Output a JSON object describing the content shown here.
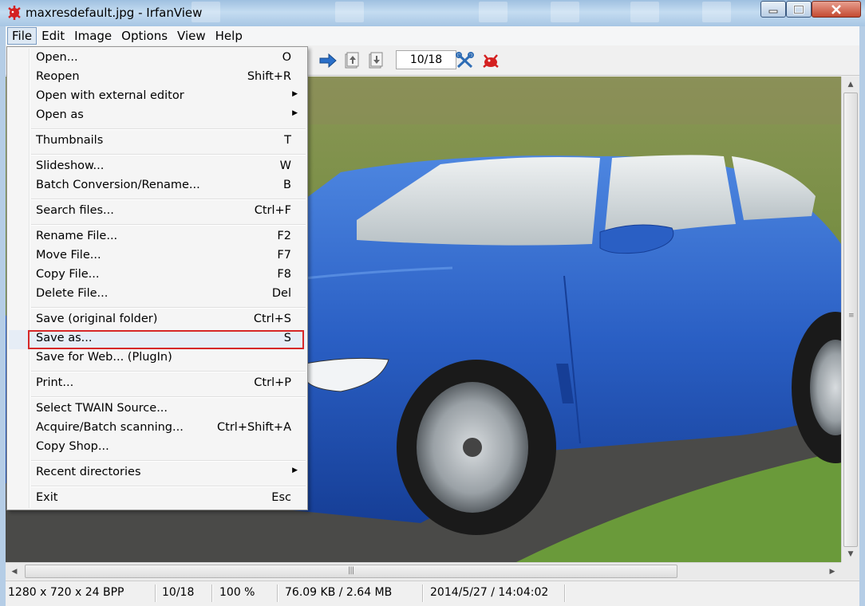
{
  "window": {
    "title": "maxresdefault.jpg - IrfanView"
  },
  "menubar": {
    "items": [
      "File",
      "Edit",
      "Image",
      "Options",
      "View",
      "Help"
    ],
    "active": "File"
  },
  "toolbar": {
    "page_indicator": "10/18",
    "icons": [
      "next-arrow-icon",
      "first-page-icon",
      "last-page-icon",
      "settings-tools-icon",
      "irfanview-logo-icon"
    ]
  },
  "file_menu": {
    "items": [
      {
        "label": "Open...",
        "key": "O"
      },
      {
        "label": "Reopen",
        "key": "Shift+R"
      },
      {
        "label": "Open with external editor",
        "key": "",
        "submenu": true
      },
      {
        "label": "Open as",
        "key": "",
        "submenu": true
      },
      {
        "label": "Thumbnails",
        "key": "T"
      },
      {
        "label": "Slideshow...",
        "key": "W"
      },
      {
        "label": "Batch Conversion/Rename...",
        "key": "B"
      },
      {
        "label": "Search files...",
        "key": "Ctrl+F"
      },
      {
        "label": "Rename File...",
        "key": "F2"
      },
      {
        "label": "Move File...",
        "key": "F7"
      },
      {
        "label": "Copy File...",
        "key": "F8"
      },
      {
        "label": "Delete File...",
        "key": "Del"
      },
      {
        "label": "Save (original folder)",
        "key": "Ctrl+S"
      },
      {
        "label": "Save as...",
        "key": "S",
        "highlighted": true
      },
      {
        "label": "Save for Web... (PlugIn)",
        "key": ""
      },
      {
        "label": "Print...",
        "key": "Ctrl+P"
      },
      {
        "label": "Select TWAIN Source...",
        "key": ""
      },
      {
        "label": "Acquire/Batch scanning...",
        "key": "Ctrl+Shift+A"
      },
      {
        "label": "Copy Shop...",
        "key": ""
      },
      {
        "label": "Recent directories",
        "key": "",
        "submenu": true
      },
      {
        "label": "Exit",
        "key": "Esc"
      }
    ]
  },
  "statusbar": {
    "dimensions": "1280 x 720 x 24 BPP",
    "position": "10/18",
    "zoom": "100 %",
    "filesize": "76.09 KB / 2.64 MB",
    "datetime": "2014/5/27 / 14:04:02"
  },
  "colors": {
    "highlight_border": "#d62828",
    "car_body": "#2a5fc4",
    "grass": "#6e8a3a",
    "road": "#4a4a48"
  }
}
